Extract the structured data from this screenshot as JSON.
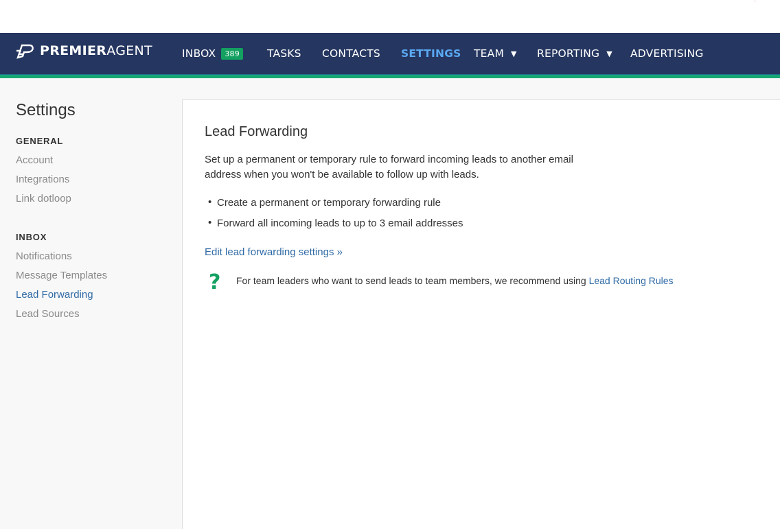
{
  "nav": {
    "logo_bold": "PREMIER",
    "logo_light": "AGENT",
    "items": [
      {
        "label": "INBOX",
        "badge": "389"
      },
      {
        "label": "TASKS"
      },
      {
        "label": "CONTACTS"
      },
      {
        "label": "SETTINGS",
        "active": true
      },
      {
        "label": "TEAM",
        "caret": "▼"
      },
      {
        "label": "REPORTING",
        "caret": "▼"
      },
      {
        "label": "ADVERTISING"
      }
    ]
  },
  "sidebar": {
    "title": "Settings",
    "general_heading": "GENERAL",
    "general_items": [
      "Account",
      "Integrations",
      "Link dotloop"
    ],
    "inbox_heading": "INBOX",
    "inbox_items": [
      "Notifications",
      "Message Templates",
      "Lead Forwarding",
      "Lead Sources"
    ],
    "active_item": "Lead Forwarding"
  },
  "content": {
    "title": "Lead Forwarding",
    "description": "Set up a permanent or temporary rule to forward incoming leads to another email address when you won't be available to follow up with leads.",
    "bullets": [
      "Create a permanent or temporary forwarding rule",
      "Forward all incoming leads to up to 3 email addresses"
    ],
    "edit_link": "Edit lead forwarding settings »",
    "help_icon": "?",
    "help_text": "For team leaders who want to send leads to team members, we recommend using ",
    "help_link": "Lead Routing Rules"
  },
  "colors": {
    "navbar": "#253660",
    "accent_green": "#16a673",
    "active_nav": "#5aa9f2",
    "link_blue": "#2f6aa5",
    "badge_green": "#13a060"
  }
}
